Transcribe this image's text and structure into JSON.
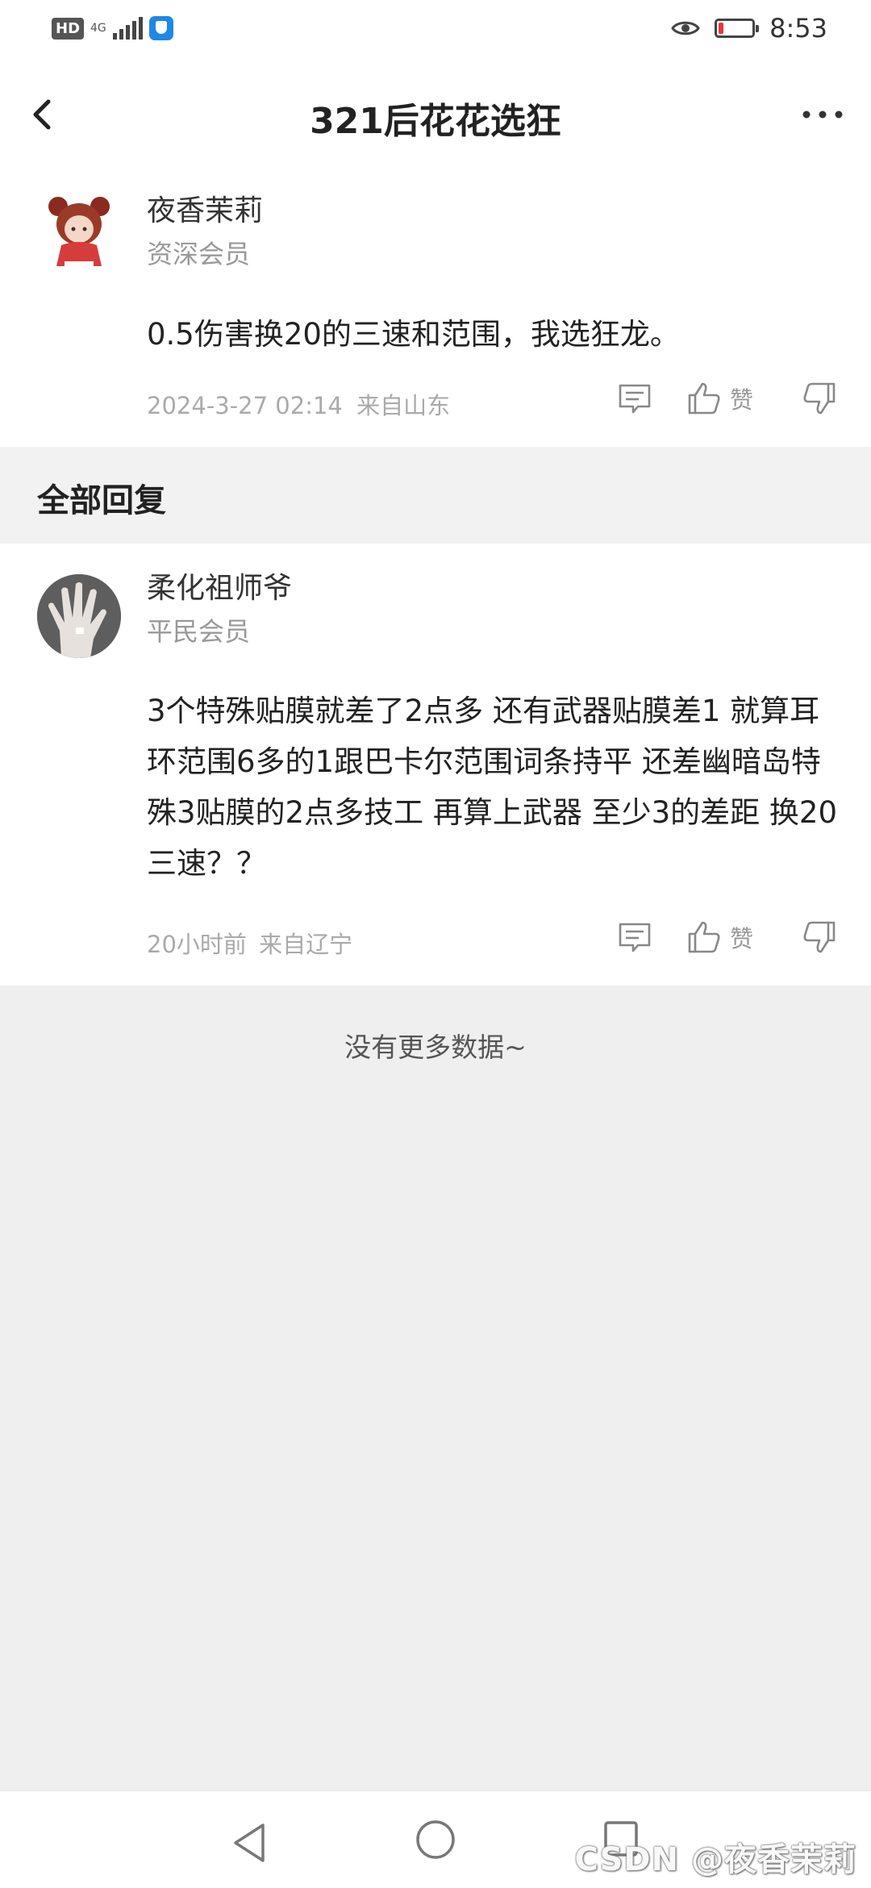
{
  "status_bar": {
    "hd": "HD",
    "network": "4G",
    "time": "8:53",
    "icons": [
      "signal-icon",
      "shield-icon",
      "eye-icon",
      "battery-icon"
    ]
  },
  "header": {
    "title": "321后花花选狂",
    "back_icon": "chevron-left-icon",
    "more_icon": "more-dots-icon"
  },
  "post": {
    "username": "夜香茉莉",
    "rank": "资深会员",
    "content": "0.5伤害换20的三速和范围，我选狂龙。",
    "timestamp": "2024-3-27 02:14",
    "location": "来自山东",
    "like_label": "赞"
  },
  "replies_section": {
    "title": "全部回复"
  },
  "reply": {
    "username": "柔化祖师爷",
    "rank": "平民会员",
    "content": "3个特殊贴膜就差了2点多 还有武器贴膜差1 就算耳环范围6多的1跟巴卡尔范围词条持平 还差幽暗岛特殊3贴膜的2点多技工 再算上武器  至少3的差距 换20三速？？",
    "timestamp": "20小时前",
    "location": "来自辽宁",
    "like_label": "赞"
  },
  "footer": {
    "no_more": "没有更多数据~"
  },
  "system_nav": {
    "watermark": "CSDN @夜香茉莉"
  },
  "colors": {
    "accent_red": "#e53935",
    "background": "#efefef"
  }
}
